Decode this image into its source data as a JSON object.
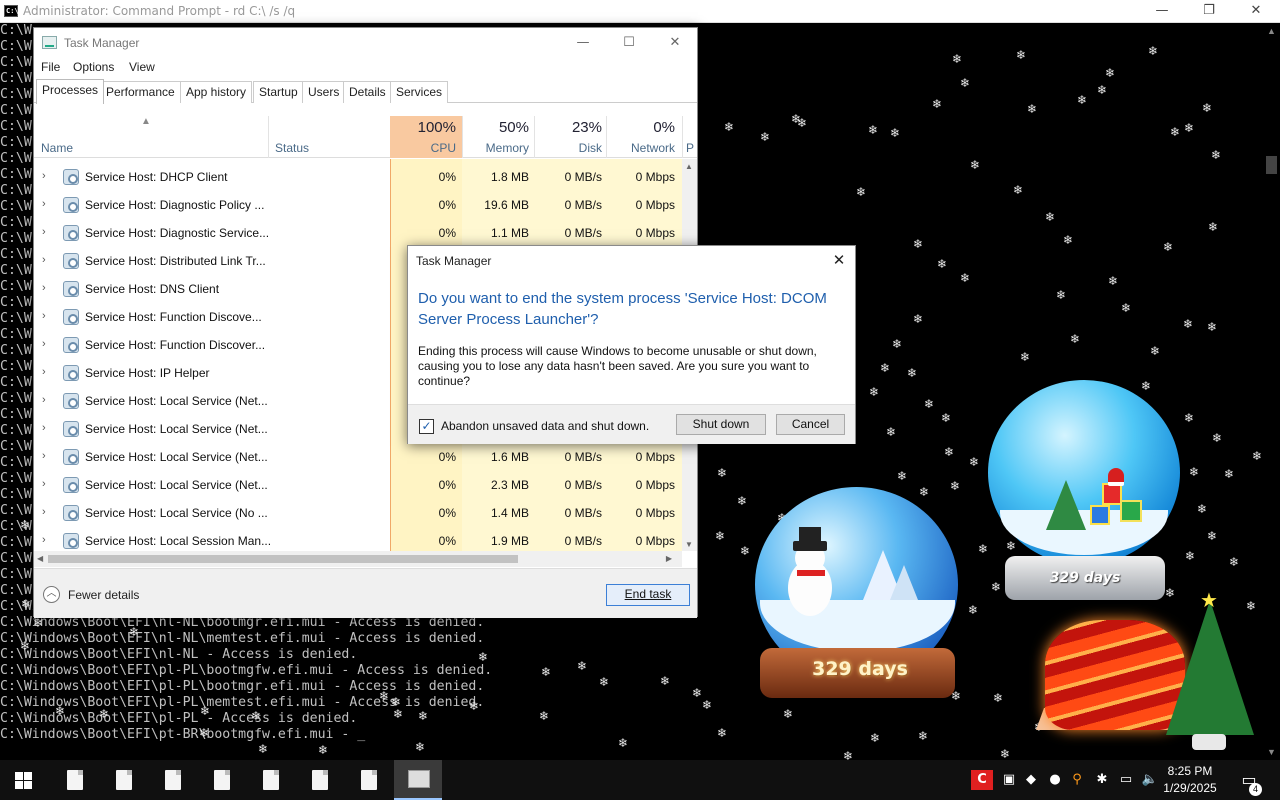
{
  "console": {
    "title": "Administrator: Command Prompt - rd  C:\\ /s /q",
    "minimize_glyph": "—",
    "maximize_glyph": "❐",
    "close_glyph": "✕",
    "lines": [
      "C:\\W",
      "C:\\W",
      "C:\\W",
      "C:\\W",
      "C:\\W",
      "C:\\W",
      "C:\\W",
      "C:\\W",
      "C:\\W",
      "C:\\W",
      "C:\\W",
      "C:\\W",
      "C:\\W",
      "C:\\W",
      "C:\\W",
      "C:\\W",
      "C:\\W",
      "C:\\W",
      "C:\\W",
      "C:\\W",
      "C:\\W",
      "C:\\W",
      "C:\\W",
      "C:\\W",
      "C:\\W",
      "C:\\W",
      "C:\\W",
      "C:\\W",
      "C:\\W",
      "C:\\W",
      "C:\\W",
      "C:\\W",
      "C:\\W",
      "C:\\W",
      "C:\\W",
      "C:\\W",
      "C:\\Windows\\Boot\\EFI\\nl-NL\\bootmgfw.efi.mui - Access is denied.",
      "C:\\Windows\\Boot\\EFI\\nl-NL\\bootmgr.efi.mui - Access is denied.",
      "C:\\Windows\\Boot\\EFI\\nl-NL\\memtest.efi.mui - Access is denied.",
      "C:\\Windows\\Boot\\EFI\\nl-NL - Access is denied.",
      "C:\\Windows\\Boot\\EFI\\pl-PL\\bootmgfw.efi.mui - Access is denied.",
      "C:\\Windows\\Boot\\EFI\\pl-PL\\bootmgr.efi.mui - Access is denied.",
      "C:\\Windows\\Boot\\EFI\\pl-PL\\memtest.efi.mui - Access is denied.",
      "C:\\Windows\\Boot\\EFI\\pl-PL - Access is denied.",
      "C:\\Windows\\Boot\\EFI\\pt-BR\\bootmgfw.efi.mui - _"
    ]
  },
  "task_manager": {
    "title": "Task Manager",
    "window_controls": {
      "minimize": "—",
      "maximize": "☐",
      "close": "✕"
    },
    "menu": [
      "File",
      "Options",
      "View"
    ],
    "tabs": [
      "Processes",
      "Performance",
      "App history",
      "Startup",
      "Users",
      "Details",
      "Services"
    ],
    "active_tab": "Processes",
    "columns": {
      "name": "Name",
      "status": "Status",
      "cpu": {
        "pct": "100%",
        "label": "CPU"
      },
      "memory": {
        "pct": "50%",
        "label": "Memory"
      },
      "disk": {
        "pct": "23%",
        "label": "Disk"
      },
      "network": {
        "pct": "0%",
        "label": "Network"
      },
      "power_partial": "P"
    },
    "processes": [
      {
        "name": "Service Host: DHCP Client",
        "cpu": "0%",
        "memory": "1.8 MB",
        "disk": "0 MB/s",
        "network": "0 Mbps"
      },
      {
        "name": "Service Host: Diagnostic Policy ...",
        "cpu": "0%",
        "memory": "19.6 MB",
        "disk": "0 MB/s",
        "network": "0 Mbps"
      },
      {
        "name": "Service Host: Diagnostic Service...",
        "cpu": "0%",
        "memory": "1.1 MB",
        "disk": "0 MB/s",
        "network": "0 Mbps"
      },
      {
        "name": "Service Host: Distributed Link Tr...",
        "cpu": "",
        "memory": "",
        "disk": "",
        "network": ""
      },
      {
        "name": "Service Host: DNS Client",
        "cpu": "",
        "memory": "",
        "disk": "",
        "network": ""
      },
      {
        "name": "Service Host: Function Discove...",
        "cpu": "",
        "memory": "",
        "disk": "",
        "network": ""
      },
      {
        "name": "Service Host: Function Discover...",
        "cpu": "",
        "memory": "",
        "disk": "",
        "network": ""
      },
      {
        "name": "Service Host: IP Helper",
        "cpu": "",
        "memory": "",
        "disk": "",
        "network": ""
      },
      {
        "name": "Service Host: Local Service (Net...",
        "cpu": "",
        "memory": "",
        "disk": "",
        "network": ""
      },
      {
        "name": "Service Host: Local Service (Net...",
        "cpu": "",
        "memory": "",
        "disk": "",
        "network": ""
      },
      {
        "name": "Service Host: Local Service (Net...",
        "cpu": "0%",
        "memory": "1.6 MB",
        "disk": "0 MB/s",
        "network": "0 Mbps"
      },
      {
        "name": "Service Host: Local Service (Net...",
        "cpu": "0%",
        "memory": "2.3 MB",
        "disk": "0 MB/s",
        "network": "0 Mbps"
      },
      {
        "name": "Service Host: Local Service (No ...",
        "cpu": "0%",
        "memory": "1.4 MB",
        "disk": "0 MB/s",
        "network": "0 Mbps"
      },
      {
        "name": "Service Host: Local Session Man...",
        "cpu": "0%",
        "memory": "1.9 MB",
        "disk": "0 MB/s",
        "network": "0 Mbps"
      }
    ],
    "fewer_details": "Fewer details",
    "end_task": "End task"
  },
  "dialog": {
    "title": "Task Manager",
    "close_glyph": "✕",
    "heading": "Do you want to end the system process 'Service Host: DCOM Server Process Launcher'?",
    "body": "Ending this process will cause Windows to become unusable or shut down, causing you to lose any data hasn't been saved. Are you sure you want to continue?",
    "checkbox_label": "Abandon unsaved data and shut down.",
    "checkbox_checked": true,
    "check_glyph": "✓",
    "shutdown_button": "Shut down",
    "cancel_button": "Cancel"
  },
  "desktop": {
    "globe_left_label": "329 days",
    "globe_right_label": "329 days",
    "snowflake_glyph": "❄"
  },
  "taskbar": {
    "time": "8:25 PM",
    "date": "1/29/2025",
    "notification_count": "4",
    "tray_icons": [
      "security-icon",
      "network-adapter-icon",
      "dropbox-icon",
      "ink-icon",
      "search-icon",
      "settings-icon",
      "network-icon",
      "volume-icon"
    ],
    "tray_glyphs": [
      "C",
      "▣",
      "◆",
      "●",
      "⚲",
      "✱",
      "▭",
      "🔈"
    ],
    "accent_color": "#9ac7ff"
  }
}
